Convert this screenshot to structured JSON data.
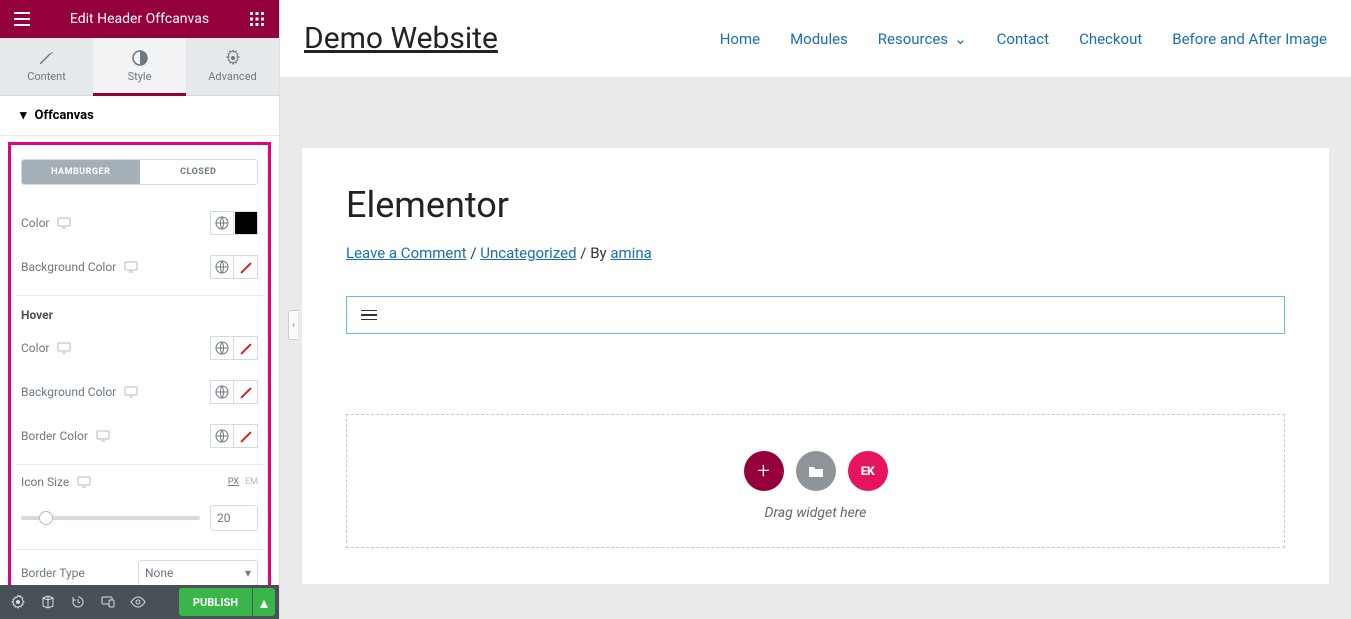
{
  "sidebar": {
    "title": "Edit Header Offcanvas",
    "tabs": {
      "content": "Content",
      "style": "Style",
      "advanced": "Advanced"
    },
    "section": "Offcanvas",
    "toggle": {
      "hamburger": "HAMBURGER",
      "closed": "CLOSED"
    },
    "labels": {
      "color": "Color",
      "bgcolor": "Background Color",
      "bordercolor": "Border Color",
      "iconsize": "Icon Size",
      "bordertype": "Border Type",
      "hover": "Hover"
    },
    "units": {
      "px": "PX",
      "em": "EM"
    },
    "iconsize_value": "20",
    "bordertype_value": "None",
    "publish": "PUBLISH"
  },
  "header": {
    "logo": "Demo Website",
    "nav": [
      "Home",
      "Modules",
      "Resources",
      "Contact",
      "Checkout",
      "Before and After Image"
    ]
  },
  "page": {
    "title": "Elementor",
    "comment": "Leave a Comment",
    "sep1": " / ",
    "category": "Uncategorized",
    "by": " / By ",
    "author": "amina",
    "dropzone": "Drag widget here",
    "ek": "EK"
  }
}
